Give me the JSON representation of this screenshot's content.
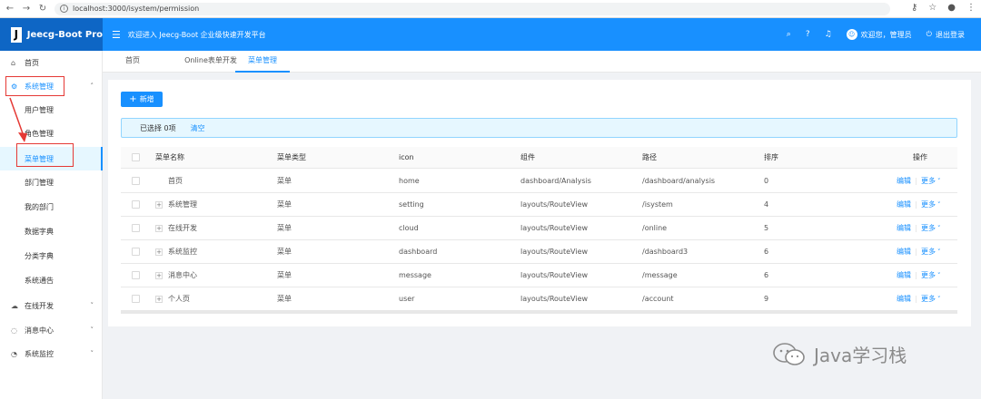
{
  "browser": {
    "url": "localhost:3000/isystem/permission"
  },
  "header": {
    "logo_letter": "J",
    "app_name": "Jeecg-Boot Pro",
    "welcome": "欢迎进入 Jeecg-Boot 企业级快速开发平台",
    "user_greeting": "欢迎您，管理员",
    "logout": "退出登录"
  },
  "sidebar": {
    "home": "首页",
    "system": "系统管理",
    "sub_items": [
      "用户管理",
      "角色管理",
      "菜单管理",
      "部门管理",
      "我的部门",
      "数据字典",
      "分类字典",
      "系统通告"
    ],
    "online": "在线开发",
    "message": "消息中心",
    "monitor": "系统监控"
  },
  "tabs": [
    "首页",
    "Online表单开发",
    "菜单管理"
  ],
  "toolbar": {
    "add_label": "新增",
    "add_icon": "plus-icon"
  },
  "alert": {
    "selected": "已选择 0项",
    "clear": "清空"
  },
  "table": {
    "columns": [
      "菜单名称",
      "菜单类型",
      "icon",
      "组件",
      "路径",
      "排序",
      "操作"
    ],
    "rows": [
      {
        "name": "首页",
        "type": "菜单",
        "icon": "home",
        "component": "dashboard/Analysis",
        "path": "/dashboard/analysis",
        "sort": "0",
        "expandable": false
      },
      {
        "name": "系统管理",
        "type": "菜单",
        "icon": "setting",
        "component": "layouts/RouteView",
        "path": "/isystem",
        "sort": "4",
        "expandable": true
      },
      {
        "name": "在线开发",
        "type": "菜单",
        "icon": "cloud",
        "component": "layouts/RouteView",
        "path": "/online",
        "sort": "5",
        "expandable": true
      },
      {
        "name": "系统监控",
        "type": "菜单",
        "icon": "dashboard",
        "component": "layouts/RouteView",
        "path": "/dashboard3",
        "sort": "6",
        "expandable": true
      },
      {
        "name": "消息中心",
        "type": "菜单",
        "icon": "message",
        "component": "layouts/RouteView",
        "path": "/message",
        "sort": "6",
        "expandable": true
      },
      {
        "name": "个人页",
        "type": "菜单",
        "icon": "user",
        "component": "layouts/RouteView",
        "path": "/account",
        "sort": "9",
        "expandable": true
      }
    ],
    "edit_label": "编辑",
    "more_label": "更多"
  },
  "watermark": {
    "text": "Java学习栈"
  },
  "colors": {
    "primary": "#1890ff",
    "logo_bg": "#0e66c5",
    "annotation_red": "#e53935"
  }
}
